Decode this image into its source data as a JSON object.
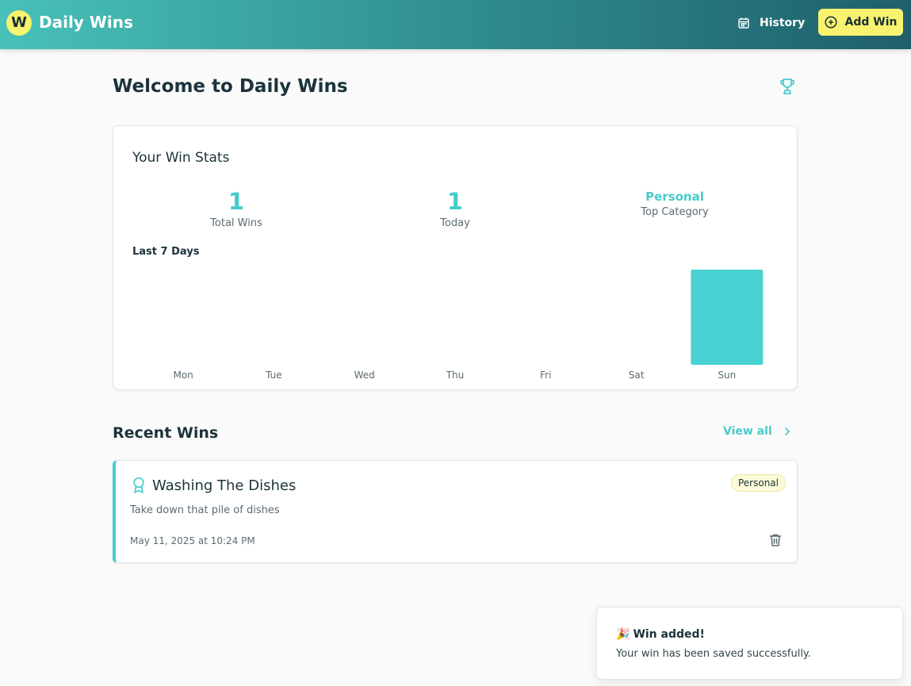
{
  "header": {
    "logo_letter": "W",
    "app_title": "Daily Wins",
    "history_label": "History",
    "add_label": "Add Win",
    "history_icon": "calendar-icon",
    "add_icon": "plus-circle-icon"
  },
  "page": {
    "title": "Welcome to Daily Wins",
    "title_icon": "trophy-icon"
  },
  "stats": {
    "title": "Your Win Stats",
    "total_value": "1",
    "total_label": "Total Wins",
    "today_value": "1",
    "today_label": "Today",
    "top_category_value": "Personal",
    "top_category_label": "Top Category",
    "chart_title": "Last 7 Days"
  },
  "chart_data": {
    "type": "bar",
    "title": "Last 7 Days",
    "categories": [
      "Mon",
      "Tue",
      "Wed",
      "Thu",
      "Fri",
      "Sat",
      "Sun"
    ],
    "values": [
      0,
      0,
      0,
      0,
      0,
      0,
      1
    ],
    "ylim": [
      0,
      1
    ],
    "grid": false,
    "color": "#48d1d0"
  },
  "recent": {
    "title": "Recent Wins",
    "view_all_label": "View all",
    "items": [
      {
        "title": "Washing The Dishes",
        "description": "Take down that pile of dishes",
        "category": "Personal",
        "date": "May 11, 2025 at 10:24 PM",
        "icon": "award-ribbon-icon"
      }
    ]
  },
  "toast": {
    "emoji": "🎉",
    "title": "Win added!",
    "message": "Your win has been saved successfully."
  },
  "colors": {
    "accent": "#48cccb",
    "brand_yellow": "#f7f36e",
    "header_start": "#48c1b9",
    "header_end": "#1f5f6c"
  }
}
